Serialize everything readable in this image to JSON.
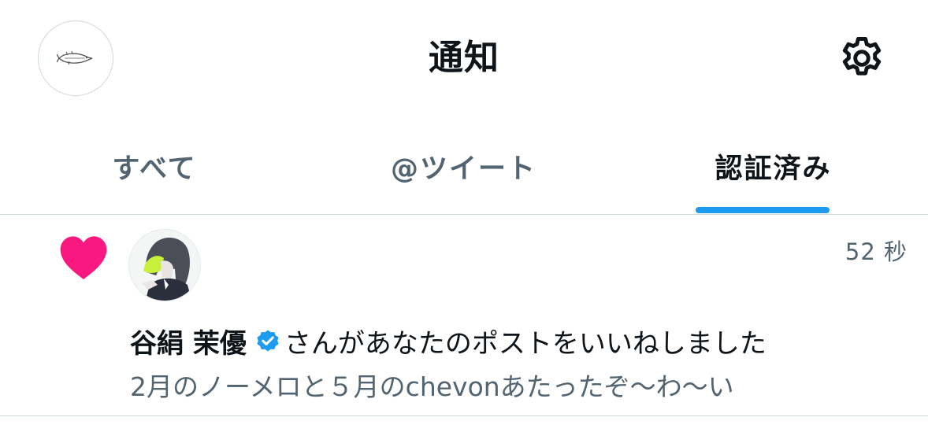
{
  "header": {
    "title": "通知",
    "avatar_icon": "fish-sketch-icon",
    "settings_icon": "gear-icon"
  },
  "tabs": [
    {
      "label": "すべて",
      "selected": false
    },
    {
      "label": "@ツイート",
      "selected": false
    },
    {
      "label": "認証済み",
      "selected": true
    }
  ],
  "notification": {
    "type_icon": "heart-icon",
    "user_name": "谷絹 茉優",
    "verified": true,
    "action_text": "さんがあなたのポストをいいねしました",
    "post_preview": "2月のノーメロと５月のchevonあたったぞ〜わ〜い",
    "timestamp": "52 秒"
  },
  "colors": {
    "accent": "#1d9bf0",
    "like": "#f91880",
    "secondary_text": "#536471",
    "divider": "#cfd9de"
  }
}
